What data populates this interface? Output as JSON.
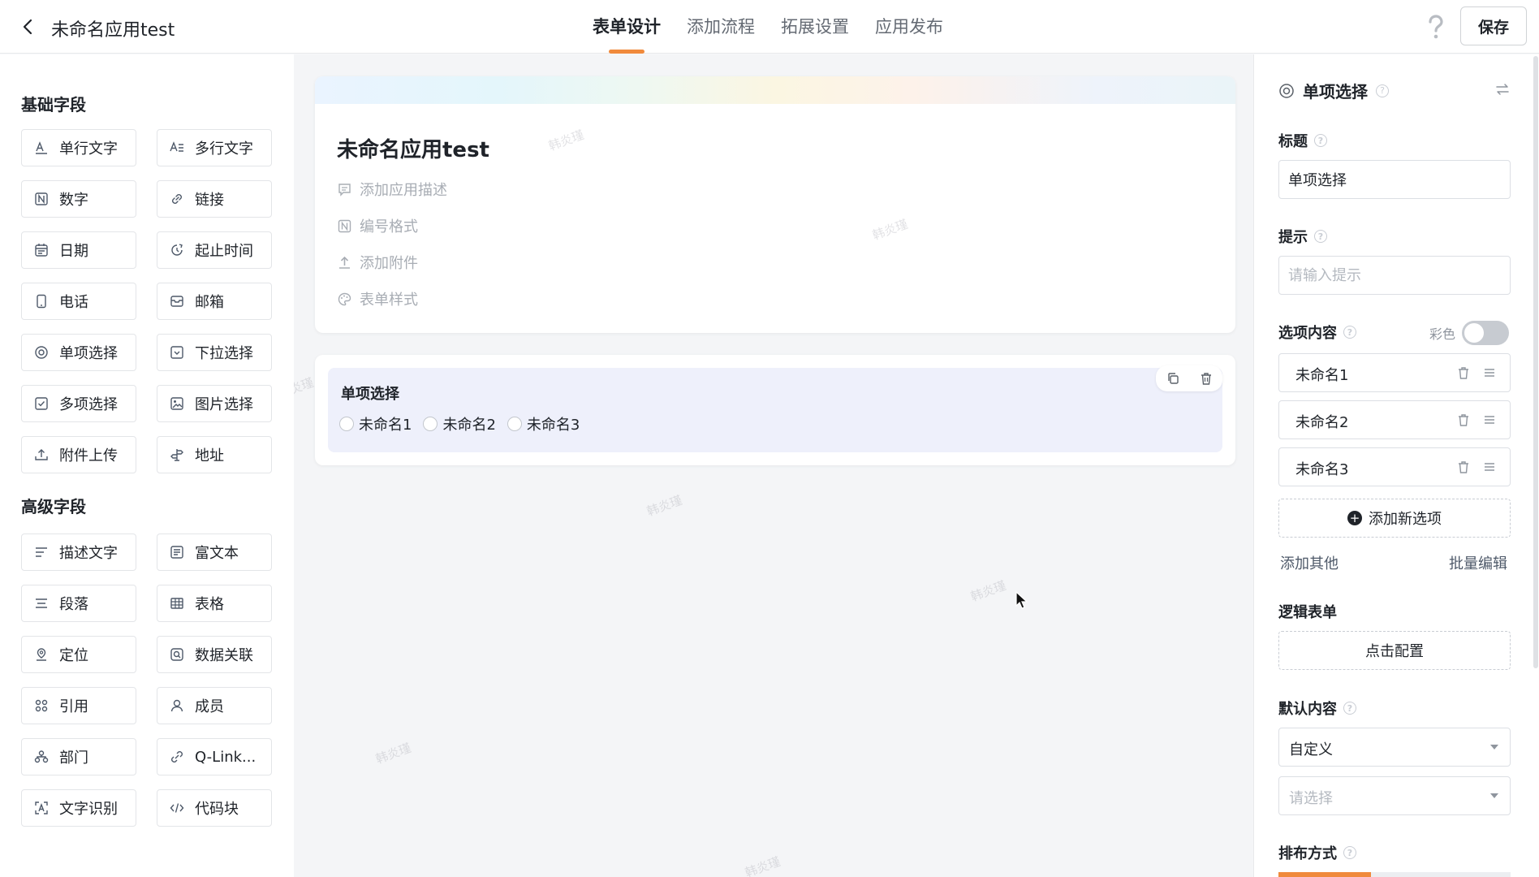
{
  "header": {
    "app_title": "未命名应用test",
    "tabs": [
      {
        "label": "表单设计",
        "active": true
      },
      {
        "label": "添加流程",
        "active": false
      },
      {
        "label": "拓展设置",
        "active": false
      },
      {
        "label": "应用发布",
        "active": false
      }
    ],
    "save_label": "保存",
    "icons": {
      "back": "chevron-left-icon",
      "help": "question-mark-icon"
    },
    "accent_color": "#f08a3c"
  },
  "left": {
    "basic_title": "基础字段",
    "basic_fields": [
      {
        "label": "单行文字",
        "icon": "single-line-text-icon"
      },
      {
        "label": "多行文字",
        "icon": "multi-line-text-icon"
      },
      {
        "label": "数字",
        "icon": "number-icon"
      },
      {
        "label": "链接",
        "icon": "link-icon"
      },
      {
        "label": "日期",
        "icon": "calendar-icon"
      },
      {
        "label": "起止时间",
        "icon": "time-range-icon"
      },
      {
        "label": "电话",
        "icon": "phone-icon"
      },
      {
        "label": "邮箱",
        "icon": "mail-icon"
      },
      {
        "label": "单项选择",
        "icon": "radio-icon"
      },
      {
        "label": "下拉选择",
        "icon": "dropdown-icon"
      },
      {
        "label": "多项选择",
        "icon": "checkbox-icon"
      },
      {
        "label": "图片选择",
        "icon": "image-icon"
      },
      {
        "label": "附件上传",
        "icon": "upload-icon"
      },
      {
        "label": "地址",
        "icon": "signpost-icon"
      }
    ],
    "advanced_title": "高级字段",
    "advanced_fields": [
      {
        "label": "描述文字",
        "icon": "description-icon"
      },
      {
        "label": "富文本",
        "icon": "rich-text-icon"
      },
      {
        "label": "段落",
        "icon": "paragraph-icon"
      },
      {
        "label": "表格",
        "icon": "table-icon"
      },
      {
        "label": "定位",
        "icon": "location-icon"
      },
      {
        "label": "数据关联",
        "icon": "data-link-icon"
      },
      {
        "label": "引用",
        "icon": "reference-icon"
      },
      {
        "label": "成员",
        "icon": "user-icon"
      },
      {
        "label": "部门",
        "icon": "department-icon"
      },
      {
        "label": "Q-Link...",
        "icon": "qlink-icon"
      },
      {
        "label": "文字识别",
        "icon": "ocr-icon"
      },
      {
        "label": "代码块",
        "icon": "code-icon"
      }
    ]
  },
  "canvas": {
    "form_title": "未命名应用test",
    "meta": [
      {
        "label": "添加应用描述",
        "icon": "comment-icon"
      },
      {
        "label": "编号格式",
        "icon": "number-format-icon"
      },
      {
        "label": "添加附件",
        "icon": "attachment-upload-icon"
      },
      {
        "label": "表单样式",
        "icon": "palette-icon"
      }
    ],
    "field": {
      "label": "单项选择",
      "options": [
        "未命名1",
        "未命名2",
        "未命名3"
      ],
      "tools": [
        "copy-icon",
        "trash-icon"
      ]
    },
    "watermark": "韩炎瑾"
  },
  "right": {
    "title": "单项选择",
    "title_label": "标题",
    "title_value": "单项选择",
    "hint_label": "提示",
    "hint_placeholder": "请输入提示",
    "options_label": "选项内容",
    "color_label": "彩色",
    "color_on": false,
    "options": [
      "未命名1",
      "未命名2",
      "未命名3"
    ],
    "add_option": "添加新选项",
    "add_other": "添加其他",
    "batch_edit": "批量编辑",
    "logic_label": "逻辑表单",
    "configure": "点击配置",
    "default_label": "默认内容",
    "default_value": "自定义",
    "select_placeholder": "请选择",
    "layout_label": "排布方式",
    "qmark": "?",
    "progress": 0.4
  }
}
